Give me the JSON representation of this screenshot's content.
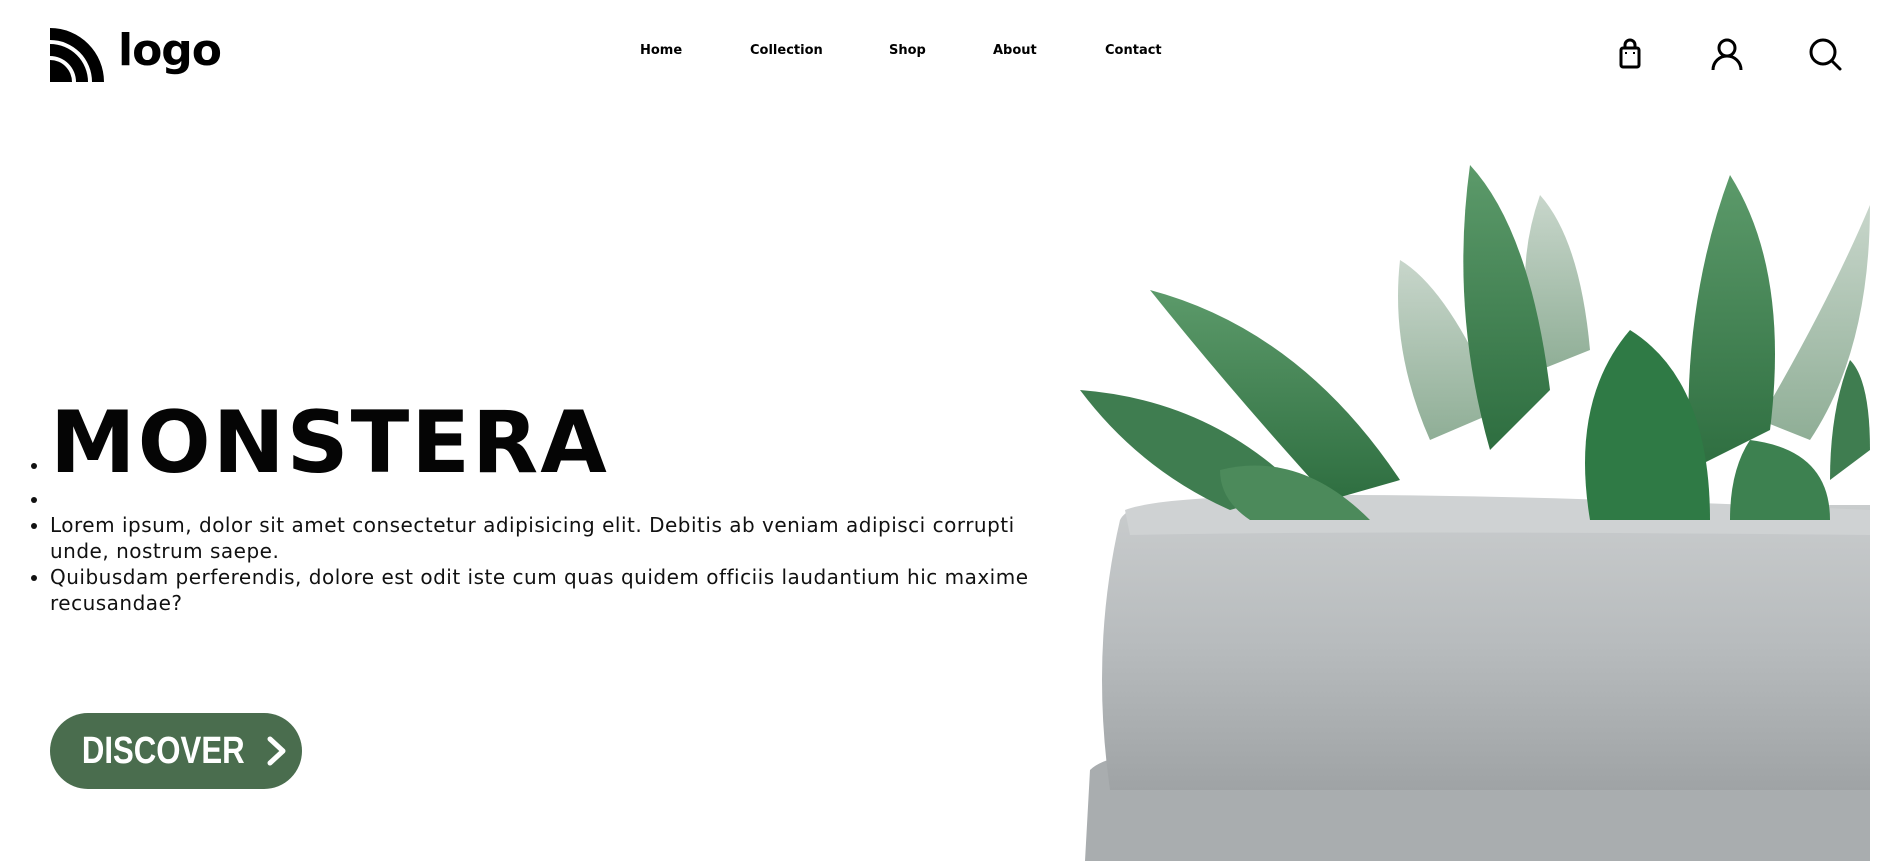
{
  "header": {
    "logo_text": "logo",
    "nav": [
      {
        "label": "Home"
      },
      {
        "label": "Collection"
      },
      {
        "label": "Shop"
      },
      {
        "label": "About"
      },
      {
        "label": "Contact"
      }
    ],
    "icons": [
      "shopping-bag-icon",
      "user-icon",
      "search-icon"
    ]
  },
  "hero": {
    "title": "MONSTERA",
    "items": [
      "",
      "Lorem ipsum, dolor sit amet consectetur adipisicing elit. Debitis ab veniam adipisci corrupti unde, nostrum saepe.",
      "Quibusdam perferendis, dolore est odit iste cum quas quidem officiis laudantium hic maxime recusandae?"
    ],
    "button_label": "DISCOVER",
    "button_icon": "chevron-right-icon"
  },
  "colors": {
    "accent": "#4a6d4e",
    "text": "#000000",
    "background": "#ffffff"
  }
}
